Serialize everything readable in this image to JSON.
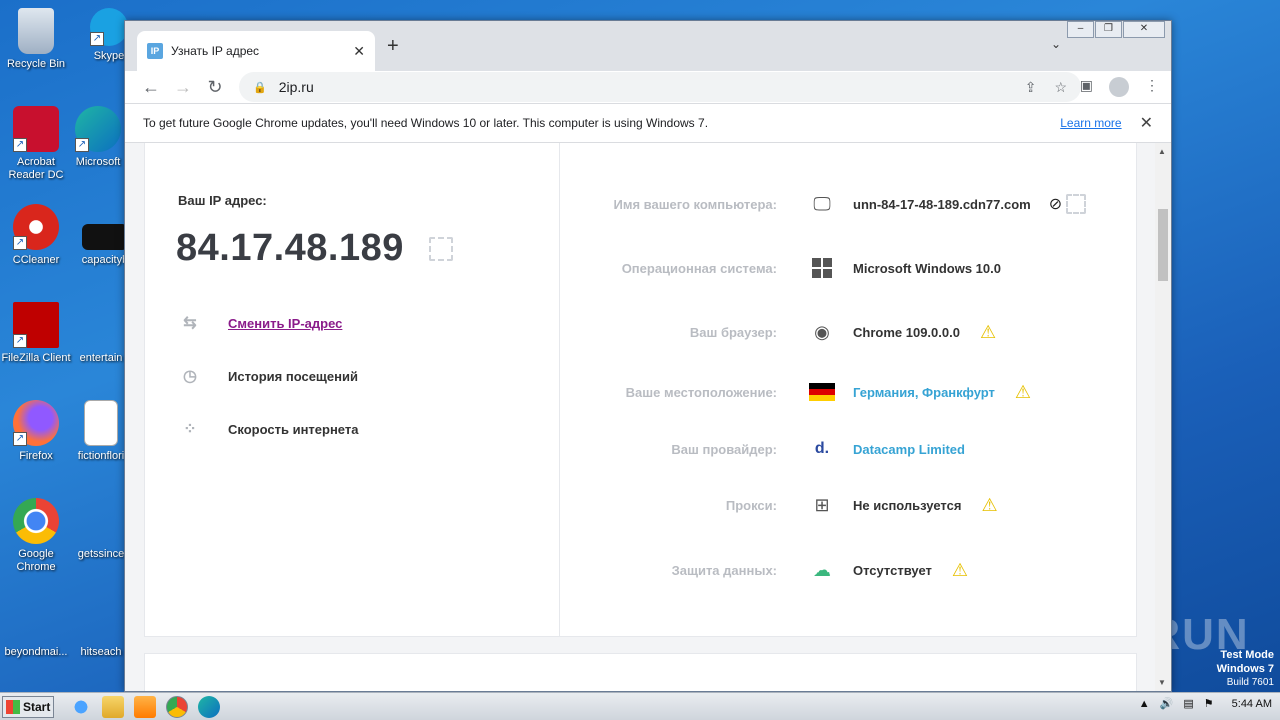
{
  "desktop": {
    "icons": [
      {
        "label": "Recycle Bin"
      },
      {
        "label": "Skype"
      },
      {
        "label": "Acrobat Reader DC"
      },
      {
        "label": "Microsoft"
      },
      {
        "label": "CCleaner"
      },
      {
        "label": "capacityb"
      },
      {
        "label": "FileZilla Client"
      },
      {
        "label": "entertain"
      },
      {
        "label": "Firefox"
      },
      {
        "label": "fictionflori"
      },
      {
        "label": "Google Chrome"
      },
      {
        "label": "getssince"
      },
      {
        "label": "beyondmai..."
      },
      {
        "label": "hitseach"
      }
    ],
    "watermark": "ANY RUN",
    "test_mode": {
      "line1": "Test Mode",
      "line2": "Windows 7",
      "line3": "Build 7601"
    }
  },
  "browser": {
    "tab": {
      "favicon_text": "IP",
      "title": "Узнать IP адрес"
    },
    "url": "2ip.ru",
    "infobar": {
      "message": "To get future Google Chrome updates, you'll need Windows 10 or later. This computer is using Windows 7.",
      "learn_more": "Learn more"
    }
  },
  "page": {
    "ip_label": "Ваш IP адрес:",
    "ip_value": "84.17.48.189",
    "menu": [
      {
        "label": "Сменить IP-адрес",
        "icon": "swap-icon"
      },
      {
        "label": "История посещений",
        "icon": "history-icon"
      },
      {
        "label": "Скорость интернета",
        "icon": "speed-icon"
      }
    ],
    "info_rows": [
      {
        "label": "Имя вашего компьютера:",
        "value": "unn-84-17-48-189.cdn77.com",
        "icon": "monitor-icon"
      },
      {
        "label": "Операционная система:",
        "value": "Microsoft Windows 10.0",
        "icon": "windows-icon"
      },
      {
        "label": "Ваш браузер:",
        "value": "Chrome 109.0.0.0",
        "icon": "chrome-icon"
      },
      {
        "label": "Ваше местоположение:",
        "value": "Германия, Франкфурт",
        "icon": "germany-flag-icon"
      },
      {
        "label": "Ваш провайдер:",
        "value": "Datacamp Limited",
        "icon": "provider-icon",
        "icon_text": "d."
      },
      {
        "label": "Прокси:",
        "value": "Не используется",
        "icon": "proxy-icon"
      },
      {
        "label": "Защита данных:",
        "value": "Отсутствует",
        "icon": "cloud-lock-icon"
      }
    ],
    "colors": {
      "link": "#8a1b8a",
      "value_blue": "#36a3d4",
      "warning": "#e6c000"
    }
  },
  "taskbar": {
    "start_label": "Start",
    "clock": "5:44 AM"
  }
}
